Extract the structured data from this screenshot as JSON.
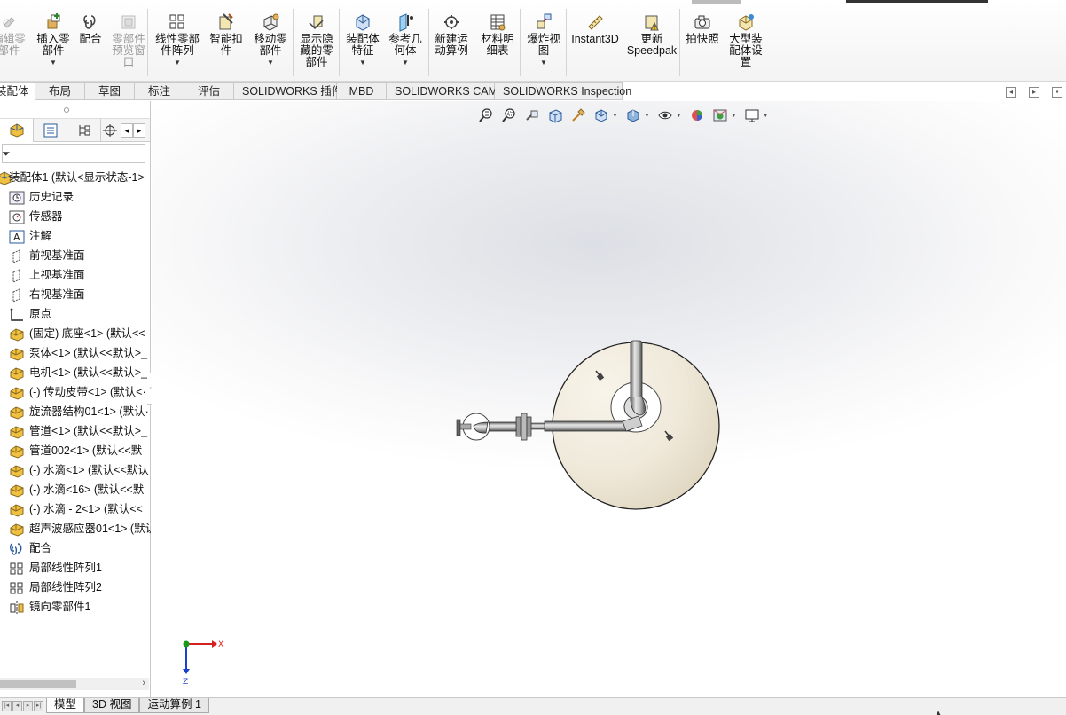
{
  "ribbon": {
    "buttons": [
      {
        "label": "编辑零\n部件",
        "icon": "edit-component-icon",
        "disabled": true
      },
      {
        "label": "插入零\n部件",
        "icon": "insert-component-icon",
        "caret": true
      },
      {
        "label": "配合",
        "icon": "mate-icon"
      },
      {
        "label": "零部件\n预览窗\n口",
        "icon": "component-preview-icon",
        "disabled": true
      },
      {
        "label": "线性零部\n件阵列",
        "icon": "linear-pattern-icon",
        "caret": true
      },
      {
        "label": "智能扣\n件",
        "icon": "smart-fasteners-icon"
      },
      {
        "label": "移动零\n部件",
        "icon": "move-component-icon",
        "caret": true
      },
      {
        "label": "显示隐\n藏的零\n部件",
        "icon": "show-hidden-icon"
      },
      {
        "label": "装配体\n特征",
        "icon": "assembly-features-icon",
        "caret": true
      },
      {
        "label": "参考几\n何体",
        "icon": "reference-geometry-icon",
        "caret": true
      },
      {
        "label": "新建运\n动算例",
        "icon": "motion-study-icon"
      },
      {
        "label": "材料明\n细表",
        "icon": "bill-of-materials-icon"
      },
      {
        "label": "爆炸视\n图",
        "icon": "exploded-view-icon",
        "caret": true
      },
      {
        "label": "Instant3D",
        "icon": "instant3d-icon"
      },
      {
        "label": "更新\nSpeedpak",
        "icon": "speedpak-icon"
      },
      {
        "label": "拍快照",
        "icon": "snapshot-icon"
      },
      {
        "label": "大型装\n配体设\n置",
        "icon": "large-assembly-icon"
      }
    ]
  },
  "command_tabs": [
    "装配体",
    "布局",
    "草图",
    "标注",
    "评估",
    "SOLIDWORKS 插件",
    "MBD",
    "SOLIDWORKS CAM",
    "SOLIDWORKS Inspection"
  ],
  "active_command_tab": "装配体",
  "feature_tree": {
    "root": "装配体1 (默认<显示状态-1>",
    "items": [
      {
        "label": "历史记录",
        "icon": "history-icon"
      },
      {
        "label": "传感器",
        "icon": "sensor-icon"
      },
      {
        "label": "注解",
        "icon": "annotation-icon"
      },
      {
        "label": "前视基准面",
        "icon": "plane-icon"
      },
      {
        "label": "上视基准面",
        "icon": "plane-icon"
      },
      {
        "label": "右视基准面",
        "icon": "plane-icon"
      },
      {
        "label": "原点",
        "icon": "origin-icon"
      },
      {
        "label": "(固定) 底座<1> (默认<<",
        "icon": "part-icon"
      },
      {
        "label": "泵体<1> (默认<<默认>_",
        "icon": "part-icon"
      },
      {
        "label": "电机<1> (默认<<默认>_",
        "icon": "part-icon"
      },
      {
        "label": "(-) 传动皮带<1> (默认<·",
        "icon": "part-icon"
      },
      {
        "label": "旋流器结构01<1> (默认·",
        "icon": "part-icon"
      },
      {
        "label": "管道<1> (默认<<默认>_",
        "icon": "part-icon"
      },
      {
        "label": "管道002<1> (默认<<默",
        "icon": "part-icon"
      },
      {
        "label": "(-) 水滴<1> (默认<<默认",
        "icon": "part-icon"
      },
      {
        "label": "(-) 水滴<16> (默认<<默",
        "icon": "part-icon"
      },
      {
        "label": "(-) 水滴 - 2<1> (默认<<",
        "icon": "part-icon"
      },
      {
        "label": "超声波感应器01<1> (默认",
        "icon": "part-icon"
      },
      {
        "label": "配合",
        "icon": "mates-folder-icon"
      },
      {
        "label": "局部线性阵列1",
        "icon": "pattern-icon"
      },
      {
        "label": "局部线性阵列2",
        "icon": "pattern-icon"
      },
      {
        "label": "镜向零部件1",
        "icon": "mirror-icon"
      }
    ]
  },
  "triad": {
    "x": "X",
    "z": "Z"
  },
  "bottom_tabs": [
    "模型",
    "3D 视图",
    "运动算例 1"
  ],
  "active_bottom_tab": "模型",
  "colors": {
    "selection_blue": "#3a6fd8",
    "axis_x": "#d42020",
    "axis_z": "#1f3fd0",
    "axis_y": "#1a9a1a",
    "tank": "#efe9da"
  }
}
